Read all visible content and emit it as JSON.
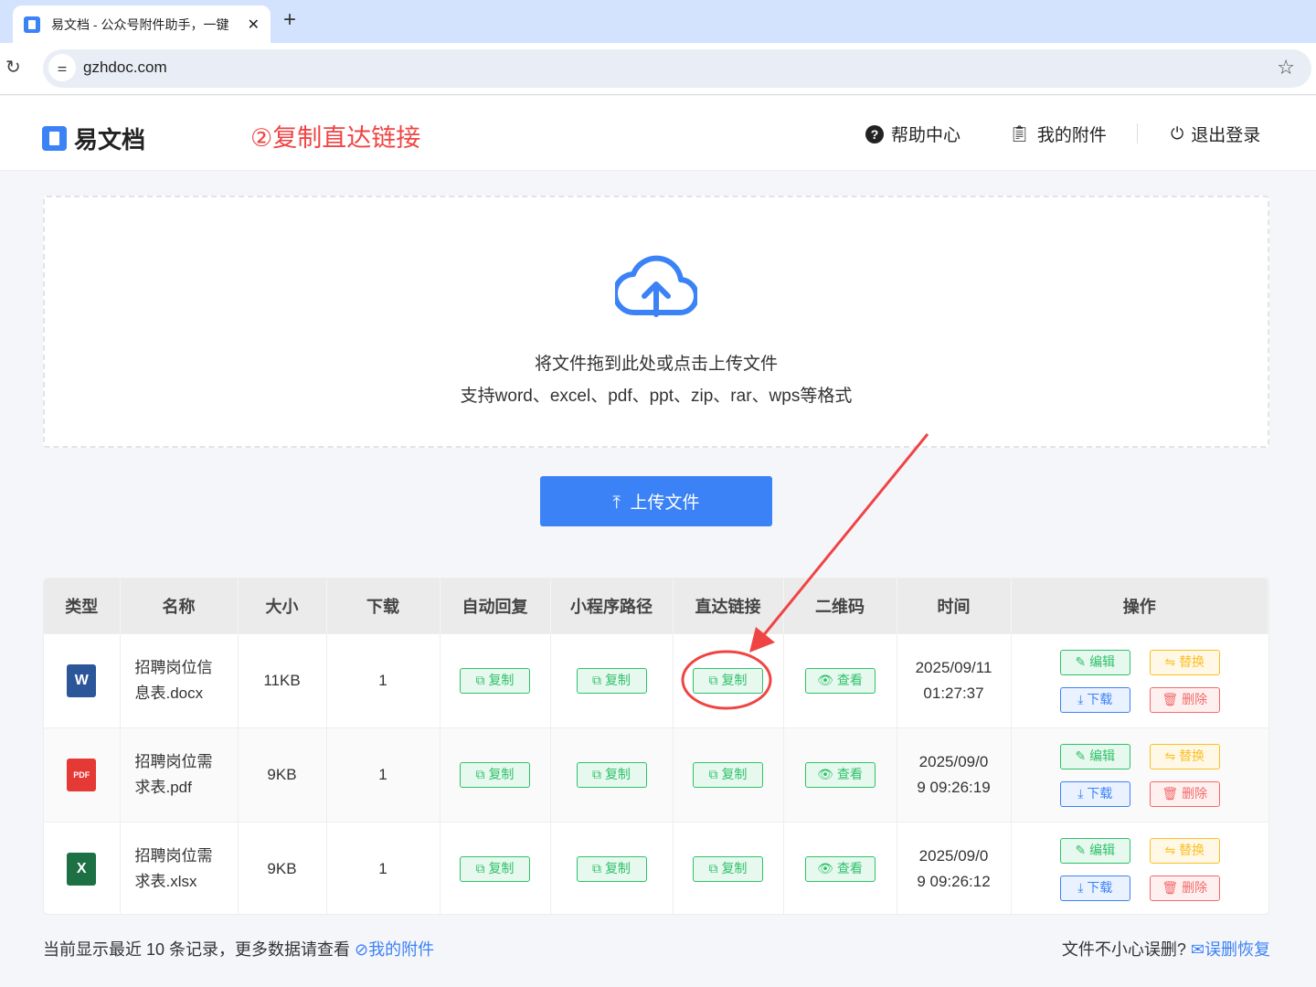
{
  "browser": {
    "tab_title": "易文档 - 公众号附件助手，一键",
    "url": "gzhdoc.com"
  },
  "header": {
    "logo": "易文档",
    "annotation": "②复制直达链接",
    "nav": [
      {
        "label": "帮助中心",
        "icon": "help-icon"
      },
      {
        "label": "我的附件",
        "icon": "clipboard-icon"
      },
      {
        "label": "退出登录",
        "icon": "power-icon"
      }
    ]
  },
  "upload": {
    "line1": "将文件拖到此处或点击上传文件",
    "line2": "支持word、excel、pdf、ppt、zip、rar、wps等格式",
    "button": "上传文件"
  },
  "table": {
    "headers": [
      "类型",
      "名称",
      "大小",
      "下载",
      "自动回复",
      "小程序路径",
      "直达链接",
      "二维码",
      "时间",
      "操作"
    ],
    "rows": [
      {
        "type": "word",
        "icon_label": "W",
        "icon_color": "#2b579a",
        "name1": "招聘岗位信",
        "name2": "息表.docx",
        "size": "11KB",
        "downloads": "1",
        "time1": "2025/09/11",
        "time2": "01:27:37"
      },
      {
        "type": "pdf",
        "icon_label": "PDF",
        "icon_color": "#e53935",
        "name1": "招聘岗位需",
        "name2": "求表.pdf",
        "size": "9KB",
        "downloads": "1",
        "time1": "2025/09/0",
        "time2": "9 09:26:19"
      },
      {
        "type": "excel",
        "icon_label": "X",
        "icon_color": "#1d7044",
        "name1": "招聘岗位需",
        "name2": "求表.xlsx",
        "size": "9KB",
        "downloads": "1",
        "time1": "2025/09/0",
        "time2": "9 09:26:12"
      }
    ],
    "copy": "复制",
    "view": "查看",
    "edit": "编辑",
    "replace": "替换",
    "download": "下载",
    "delete": "删除"
  },
  "footer": {
    "left": "当前显示最近 10 条记录，更多数据请查看",
    "left_link": "我的附件",
    "right": "文件不小心误删?",
    "right_link": "误删恢复"
  }
}
